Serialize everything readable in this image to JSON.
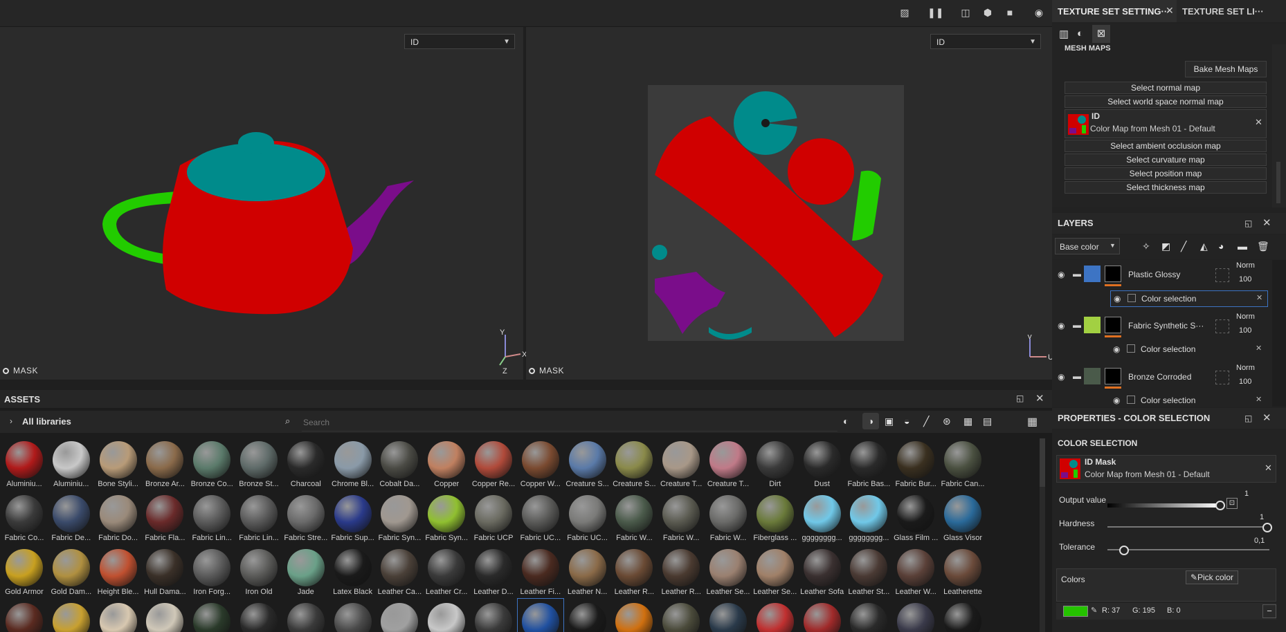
{
  "viewports": {
    "left_dropdown": "ID",
    "right_dropdown": "ID",
    "left_mask": "MASK",
    "right_mask": "MASK",
    "axes3d": {
      "y": "Y",
      "x": "X",
      "z": "Z"
    },
    "axes2d": {
      "v": "V",
      "u": "U"
    }
  },
  "right_tabs": {
    "active": "TEXTURE SET SETTING···",
    "inactive": "TEXTURE SET LI···"
  },
  "mesh_maps": {
    "title": "MESH MAPS",
    "bake_button": "Bake Mesh Maps",
    "slots": [
      "Select normal map",
      "Select world space normal map",
      "Select ambient occlusion map",
      "Select curvature map",
      "Select position map",
      "Select thickness map"
    ],
    "id_slot": {
      "name": "ID",
      "desc": "Color Map from Mesh 01 - Default"
    }
  },
  "layers": {
    "title": "LAYERS",
    "channel": "Base color",
    "items": [
      {
        "name": "Plastic Glossy",
        "blend": "Norm",
        "opacity": "100",
        "mask": "Color selection",
        "color": "#3d74c4"
      },
      {
        "name": "Fabric Synthetic S···",
        "blend": "Norm",
        "opacity": "100",
        "mask": "Color selection",
        "color": "#a2d042"
      },
      {
        "name": "Bronze Corroded",
        "blend": "Norm",
        "opacity": "100",
        "mask": "Color selection",
        "color": "#4a5a4a"
      }
    ]
  },
  "properties": {
    "title": "PROPERTIES - COLOR SELECTION",
    "section": "COLOR SELECTION",
    "id_mask": {
      "name": "ID Mask",
      "desc": "Color Map from Mesh 01 - Default"
    },
    "output": {
      "label": "Output value",
      "value": "1",
      "level": 1
    },
    "hardness": {
      "label": "Hardness",
      "value": "1",
      "level": 1
    },
    "tolerance": {
      "label": "Tolerance",
      "value": "0,1",
      "level": 0.1
    },
    "colors_label": "Colors",
    "pick_button": "Pick color",
    "color": {
      "r": "R: 37",
      "g": "G: 195",
      "b": "B: 0",
      "hex": "#25c300"
    }
  },
  "assets": {
    "title": "ASSETS",
    "library": "All libraries",
    "search_placeholder": "Search",
    "rows": [
      [
        "Aluminiu...",
        "Aluminiu...",
        "Bone Styli...",
        "Bronze Ar...",
        "Bronze Co...",
        "Bronze St...",
        "Charcoal",
        "Chrome Bl...",
        "Cobalt Da...",
        "Copper",
        "Copper Re...",
        "Copper W...",
        "Creature S...",
        "Creature S...",
        "Creature T...",
        "Creature T...",
        "Dirt",
        "Dust",
        "Fabric Bas...",
        "Fabric Bur...",
        "Fabric Can..."
      ],
      [
        "Fabric Co...",
        "Fabric De...",
        "Fabric Do...",
        "Fabric Fla...",
        "Fabric Lin...",
        "Fabric Lin...",
        "Fabric Stre...",
        "Fabric Sup...",
        "Fabric Syn...",
        "Fabric Syn...",
        "Fabric UCP",
        "Fabric UC...",
        "Fabric UC...",
        "Fabric W...",
        "Fabric W...",
        "Fabric W...",
        "Fiberglass ...",
        "gggggggg...",
        "gggggggg...",
        "Glass Film ...",
        "Glass Visor"
      ],
      [
        "Gold Armor",
        "Gold Dam...",
        "Height Ble...",
        "Hull Dama...",
        "Iron Forg...",
        "Iron Old",
        "Jade",
        "Latex Black",
        "Leather Ca...",
        "Leather Cr...",
        "Leather D...",
        "Leather Fi...",
        "Leather N...",
        "Leather R...",
        "Leather R...",
        "Leather Se...",
        "Leather Se...",
        "Leather Sofa",
        "Leather St...",
        "Leather W...",
        "Leatherette"
      ]
    ],
    "row_colors": [
      [
        "#b01a1a",
        "#c8c8c8",
        "#b89b78",
        "#8a6a4a",
        "#5a7a6a",
        "#5e6a68",
        "#2a2a2a",
        "#8a9aa8",
        "#4a4a44",
        "#c08060",
        "#b04a3a",
        "#7a4a30",
        "#5a7aa8",
        "#8a8a4a",
        "#a89888",
        "#c07a88",
        "#3a3a3a",
        "#2a2a2a",
        "#2a2a2a",
        "#3a3020",
        "#4a5040"
      ],
      [
        "#3a3a3a",
        "#3a4a6a",
        "#9a8a7a",
        "#6a2a2a",
        "#5a5a5a",
        "#5a5a5a",
        "#6a6a6a",
        "#2a3a8a",
        "#a09890",
        "#90c030",
        "#6a6a60",
        "#5a5a58",
        "#7a7a78",
        "#4a5a4a",
        "#5a5a50",
        "#6a6a68",
        "#6a7a3a",
        "#70c8e8",
        "#70c8e8",
        "#1a1a1a",
        "#2a6a9a"
      ],
      [
        "#c8a020",
        "#b09040",
        "#c05030",
        "#3a3028",
        "#5a5a5a",
        "#5a5a58",
        "#6aa088",
        "#1a1a1a",
        "#4a4038",
        "#3a3a3a",
        "#2a2a2a",
        "#4a2a20",
        "#8a6a48",
        "#6a4a34",
        "#4a3a30",
        "#9a8070",
        "#a08068",
        "#3a3030",
        "#4a3a34",
        "#5a4038",
        "#6a4a3a"
      ],
      [
        "#5a2a20",
        "#c8a030",
        "#d8c8b0",
        "#d0c8b8",
        "#2a3a2a",
        "#2a2a2a",
        "#3a3a3a",
        "#4a4a4a",
        "#a0a0a0",
        "#c8c8c8",
        "#3a3a3a",
        "#2050a0",
        "#1a1a1a",
        "#d07010",
        "#4a4a3a",
        "#2a3a4a",
        "#c03030",
        "#a02a2a",
        "#2a2a2a",
        "#3a3a4a",
        "#1a1a1a"
      ]
    ]
  }
}
